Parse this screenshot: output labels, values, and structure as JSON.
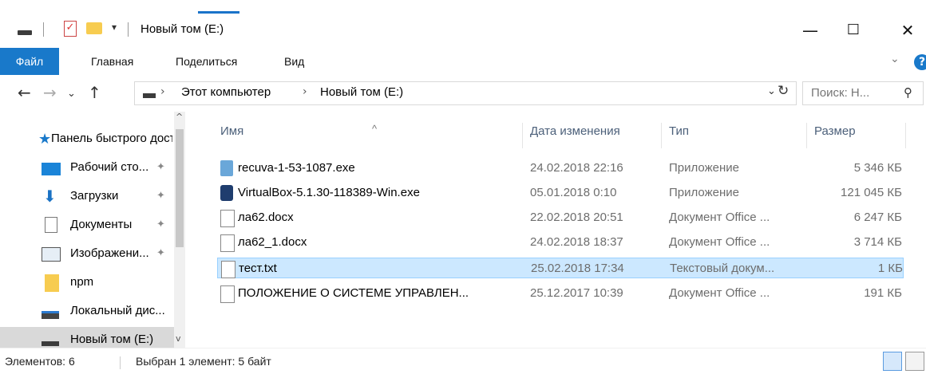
{
  "window": {
    "title": "Новый том (E:)",
    "qa_dropdown_glyph": "▾",
    "controls": {
      "minimize": "—",
      "maximize": "☐",
      "close": "✕"
    }
  },
  "ribbon": {
    "file_tab": "Файл",
    "tabs": [
      "Главная",
      "Поделиться",
      "Вид"
    ],
    "expand_glyph": "⌄",
    "help_glyph": "?"
  },
  "nav": {
    "back": "←",
    "forward": "→",
    "recent": "⌄",
    "up": "↑",
    "breadcrumb": [
      "Этот компьютер",
      "Новый том (E:)"
    ],
    "separator": "›",
    "dropdown": "⌄",
    "refresh": "↻",
    "search_placeholder": "Поиск: Н...",
    "search_icon": "⚲"
  },
  "sidebar": {
    "items": [
      {
        "label": "Панель быстрого доступа",
        "icon": "star-icon",
        "pinned": false
      },
      {
        "label": "Рабочий сто...",
        "icon": "desktop-icon",
        "pinned": true
      },
      {
        "label": "Загрузки",
        "icon": "downloads-icon",
        "pinned": true
      },
      {
        "label": "Документы",
        "icon": "documents-icon",
        "pinned": true
      },
      {
        "label": "Изображени...",
        "icon": "pictures-icon",
        "pinned": true
      },
      {
        "label": "npm",
        "icon": "folder-icon",
        "pinned": false
      },
      {
        "label": "Локальный дис...",
        "icon": "local-disk-icon",
        "pinned": false
      },
      {
        "label": "Новый том (E:)",
        "icon": "drive-icon",
        "pinned": false
      }
    ],
    "pin_glyph": "📌",
    "scroll_up": "^",
    "scroll_down": "v"
  },
  "columns": {
    "name": "Имя",
    "modified": "Дата изменения",
    "type": "Тип",
    "size": "Размер",
    "sort_glyph": "^"
  },
  "files": [
    {
      "name": "recuva-1-53-1087.exe",
      "modified": "24.02.2018 22:16",
      "type": "Приложение",
      "size": "5 346 КБ",
      "icon": "recuva-icon"
    },
    {
      "name": "VirtualBox-5.1.30-118389-Win.exe",
      "modified": "05.01.2018 0:10",
      "type": "Приложение",
      "size": "121 045 КБ",
      "icon": "virtualbox-icon"
    },
    {
      "name": "ла62.docx",
      "modified": "22.02.2018 20:51",
      "type": "Документ Office ...",
      "size": "6 247 КБ",
      "icon": "document-icon"
    },
    {
      "name": "ла62_1.docx",
      "modified": "24.02.2018 18:37",
      "type": "Документ Office ...",
      "size": "3 714 КБ",
      "icon": "document-icon"
    },
    {
      "name": "тест.txt",
      "modified": "25.02.2018 17:34",
      "type": "Текстовый докум...",
      "size": "1 КБ",
      "icon": "text-file-icon",
      "selected": true
    },
    {
      "name": "ПОЛОЖЕНИЕ О СИСТЕМЕ УПРАВЛЕН...",
      "modified": "25.12.2017 10:39",
      "type": "Документ Office ...",
      "size": "191 КБ",
      "icon": "document-icon"
    }
  ],
  "status": {
    "count": "Элементов: 6",
    "selection": "Выбран 1 элемент: 5 байт"
  },
  "colors": {
    "accent": "#1979ca",
    "selection_bg": "#cce8ff",
    "selection_border": "#99d1ff",
    "header_text": "#4c607a",
    "dim_text": "#6d6d6d"
  }
}
